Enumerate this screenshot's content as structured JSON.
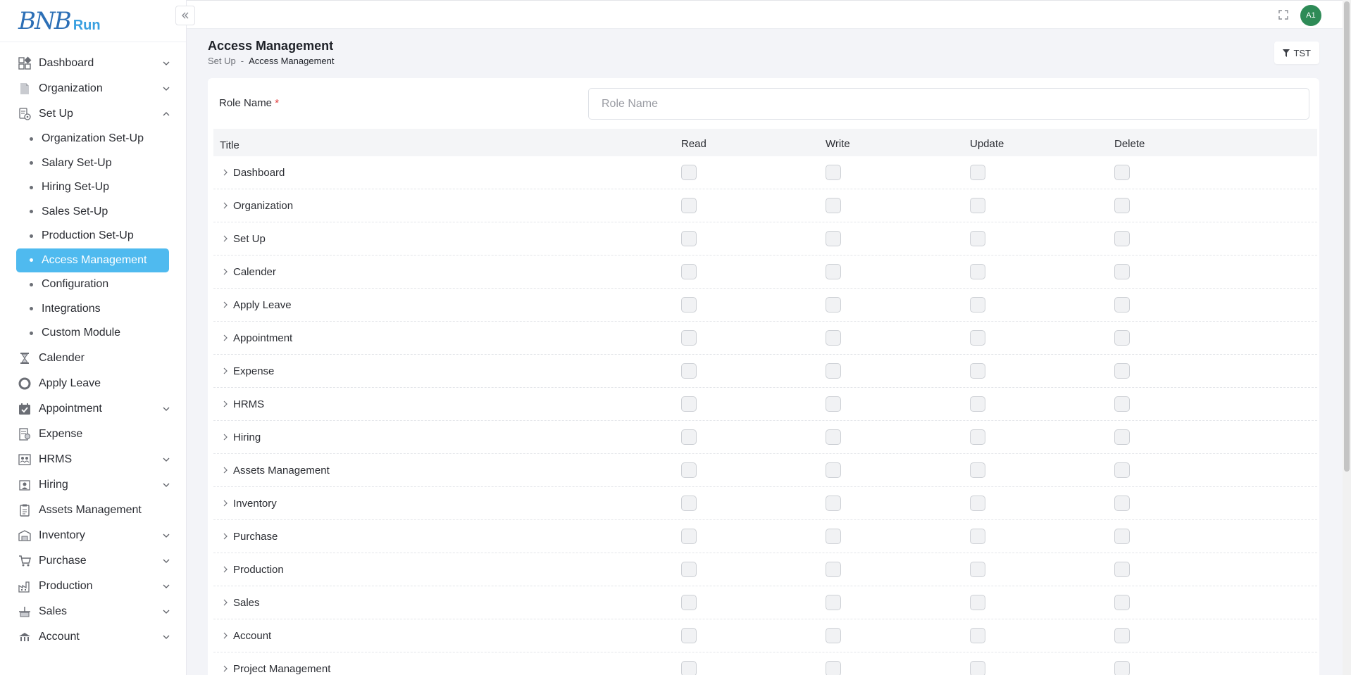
{
  "logo": {
    "mark": "BNB",
    "word": "Run"
  },
  "sidebar": {
    "items": [
      {
        "label": "Dashboard",
        "icon": "dashboard-icon",
        "chevron": "down"
      },
      {
        "label": "Organization",
        "icon": "document-icon",
        "chevron": "down"
      },
      {
        "label": "Set Up",
        "icon": "setup-icon",
        "chevron": "up"
      },
      {
        "label": "Calender",
        "icon": "hourglass-icon",
        "chevron": ""
      },
      {
        "label": "Apply Leave",
        "icon": "lifebuoy-icon",
        "chevron": ""
      },
      {
        "label": "Appointment",
        "icon": "calendar-check-icon",
        "chevron": "down"
      },
      {
        "label": "Expense",
        "icon": "receipt-icon",
        "chevron": ""
      },
      {
        "label": "HRMS",
        "icon": "people-icon",
        "chevron": "down"
      },
      {
        "label": "Hiring",
        "icon": "hiring-icon",
        "chevron": "down"
      },
      {
        "label": "Assets Management",
        "icon": "clipboard-icon",
        "chevron": ""
      },
      {
        "label": "Inventory",
        "icon": "inventory-icon",
        "chevron": "down"
      },
      {
        "label": "Purchase",
        "icon": "cart-icon",
        "chevron": "down"
      },
      {
        "label": "Production",
        "icon": "factory-icon",
        "chevron": "down"
      },
      {
        "label": "Sales",
        "icon": "sales-icon",
        "chevron": "down"
      },
      {
        "label": "Account",
        "icon": "account-icon",
        "chevron": "down"
      }
    ],
    "setup_sub": [
      "Organization Set-Up",
      "Salary Set-Up",
      "Hiring Set-Up",
      "Sales Set-Up",
      "Production Set-Up",
      "Access Management",
      "Configuration",
      "Integrations",
      "Custom Module"
    ],
    "active_sub": "Access Management"
  },
  "topbar": {
    "avatar": "A1"
  },
  "page": {
    "title": "Access Management",
    "breadcrumb": {
      "parent": "Set Up",
      "sep": "-",
      "current": "Access Management"
    },
    "filter_button": "TST"
  },
  "form": {
    "role_label": "Role Name",
    "required_mark": "*",
    "role_placeholder": "Role Name",
    "role_value": ""
  },
  "table": {
    "headers": {
      "title": "Title",
      "read": "Read",
      "write": "Write",
      "update": "Update",
      "delete": "Delete"
    },
    "rows": [
      "Dashboard",
      "Organization",
      "Set Up",
      "Calender",
      "Apply Leave",
      "Appointment",
      "Expense",
      "HRMS",
      "Hiring",
      "Assets Management",
      "Inventory",
      "Purchase",
      "Production",
      "Sales",
      "Account",
      "Project Management"
    ]
  },
  "colors": {
    "accent": "#4fbaef",
    "avatar_bg": "#2e8b57",
    "required": "#e03c3c"
  }
}
